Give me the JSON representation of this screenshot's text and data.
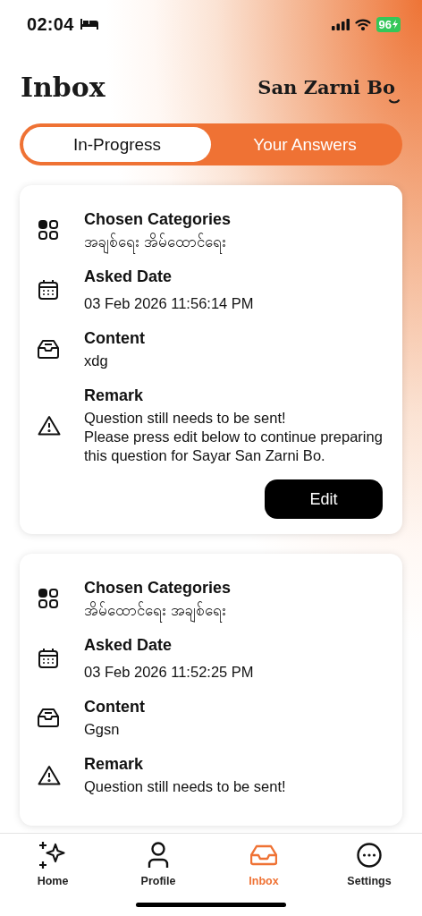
{
  "status_bar": {
    "time": "02:04",
    "battery": "96"
  },
  "header": {
    "title": "Inbox",
    "brand": "San Zarni Bo"
  },
  "segments": [
    {
      "label": "In-Progress",
      "selected": true
    },
    {
      "label": "Your Answers",
      "selected": false
    }
  ],
  "cards": [
    {
      "fields": [
        {
          "kind": "categories",
          "label": "Chosen Categories",
          "value": "အချစ်ရေး အိမ်ထောင်ရေး"
        },
        {
          "kind": "date",
          "label": "Asked Date",
          "value": "03 Feb 2026 11:56:14 PM"
        },
        {
          "kind": "content",
          "label": "Content",
          "value": "xdg"
        },
        {
          "kind": "remark",
          "label": "Remark",
          "value": "Question still needs to be sent!\nPlease press edit below to continue preparing this question for Sayar San Zarni Bo."
        }
      ],
      "button": "Edit"
    },
    {
      "fields": [
        {
          "kind": "categories",
          "label": "Chosen Categories",
          "value": "အိမ်ထောင်ရေး အချစ်ရေး"
        },
        {
          "kind": "date",
          "label": "Asked Date",
          "value": "03 Feb 2026 11:52:25 PM"
        },
        {
          "kind": "content",
          "label": "Content",
          "value": "Ggsn"
        },
        {
          "kind": "remark",
          "label": "Remark",
          "value": "Question still needs to be sent!"
        }
      ]
    }
  ],
  "tab_bar": [
    {
      "kind": "home",
      "label": "Home",
      "selected": false
    },
    {
      "kind": "profile",
      "label": "Profile",
      "selected": false
    },
    {
      "kind": "inbox",
      "label": "Inbox",
      "selected": true
    },
    {
      "kind": "settings",
      "label": "Settings",
      "selected": false
    }
  ]
}
